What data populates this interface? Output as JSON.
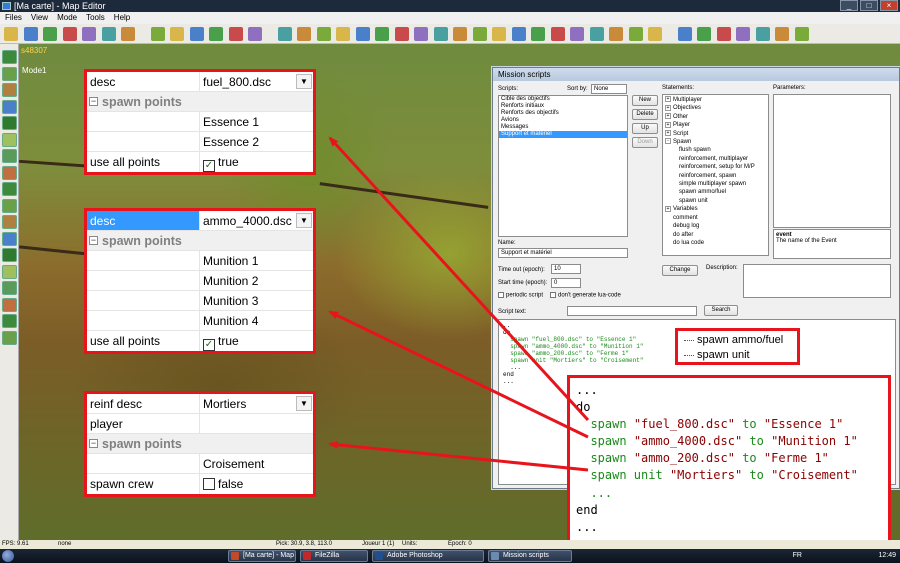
{
  "window": {
    "title": "[Ma carte] - Map Editor"
  },
  "menu": [
    "Files",
    "View",
    "Mode",
    "Tools",
    "Help"
  ],
  "viewport": {
    "coord_text": "s48307",
    "mode_text": "Mode1"
  },
  "mission_window": {
    "title": "Mission scripts",
    "scripts_label": "Scripts:",
    "sort_label": "Sort by:",
    "sort_value": "None",
    "scripts": [
      "Cible des objectifs",
      "Renforts initiaux",
      "Renforts des objectifs",
      "Avions",
      "Messages",
      "Support et matériel"
    ],
    "selected_script_index": 5,
    "buttons": {
      "new": "New",
      "delete": "Delete",
      "up": "Up",
      "down": "Down",
      "change": "Change",
      "search": "Search"
    },
    "statements_label": "Statements:",
    "parameters_label": "Parameters:",
    "statements": [
      {
        "label": "Multiplayer",
        "level": 0,
        "expander": "+"
      },
      {
        "label": "Objectives",
        "level": 0,
        "expander": "+"
      },
      {
        "label": "Other",
        "level": 0,
        "expander": "+"
      },
      {
        "label": "Player",
        "level": 0,
        "expander": "+"
      },
      {
        "label": "Script",
        "level": 0,
        "expander": "+"
      },
      {
        "label": "Spawn",
        "level": 0,
        "expander": "-"
      },
      {
        "label": "flush spawn",
        "level": 1,
        "expander": ""
      },
      {
        "label": "reinforcement, multiplayer",
        "level": 1,
        "expander": ""
      },
      {
        "label": "reinforcement, setup for M/P",
        "level": 1,
        "expander": ""
      },
      {
        "label": "reinforcement, spawn",
        "level": 1,
        "expander": ""
      },
      {
        "label": "simple multiplayer spawn",
        "level": 1,
        "expander": ""
      },
      {
        "label": "spawn ammo/fuel",
        "level": 1,
        "expander": ""
      },
      {
        "label": "spawn unit",
        "level": 1,
        "expander": ""
      },
      {
        "label": "Variables",
        "level": 0,
        "expander": "+"
      },
      {
        "label": "comment",
        "level": 0,
        "expander": ""
      },
      {
        "label": "debug log",
        "level": 0,
        "expander": ""
      },
      {
        "label": "do after",
        "level": 0,
        "expander": ""
      },
      {
        "label": "do lua code",
        "level": 0,
        "expander": ""
      }
    ],
    "event_help": {
      "title": "event",
      "text": "The name of the Event"
    },
    "name_label": "Name:",
    "name_value": "Support et matériel",
    "timeout_label": "Time out (epoch):",
    "timeout_value": "10",
    "starttime_label": "Start time (epoch):",
    "starttime_value": "0",
    "periodic_label": "periodic script",
    "nolua_label": "don't generate lua-code",
    "description_label": "Description:",
    "scripttext_label": "Script text:",
    "script_lines": [
      {
        "text": "..",
        "color": "black"
      },
      {
        "text": "do",
        "color": "black"
      },
      {
        "text": "  spawn \"fuel_800.dsc\" to \"Essence 1\"",
        "color": "green"
      },
      {
        "text": "  spawn \"ammo_4000.dsc\" to \"Munition 1\"",
        "color": "green"
      },
      {
        "text": "  spawn \"ammo_200.dsc\" to \"Ferme 1\"",
        "color": "green"
      },
      {
        "text": "  spawn unit \"Mortiers\" to \"Croisement\"",
        "color": "green"
      },
      {
        "text": "  ...",
        "color": "black"
      },
      {
        "text": "end",
        "color": "black"
      },
      {
        "text": "...",
        "color": "black"
      }
    ]
  },
  "panel_fuel": {
    "desc_key": "desc",
    "desc_value": "fuel_800.dsc",
    "section": "spawn points",
    "points": [
      "Essence 1",
      "Essence 2"
    ],
    "use_all_key": "use all points",
    "use_all_value": "true"
  },
  "panel_ammo": {
    "desc_key": "desc",
    "desc_value": "ammo_4000.dsc",
    "section": "spawn points",
    "points": [
      "Munition 1",
      "Munition 2",
      "Munition 3",
      "Munition 4"
    ],
    "use_all_key": "use all points",
    "use_all_value": "true"
  },
  "panel_unit": {
    "reinf_key": "reinf desc",
    "reinf_value": "Mortiers",
    "player_key": "player",
    "player_value": "",
    "section": "spawn points",
    "points": [
      "Croisement"
    ],
    "crew_key": "spawn crew",
    "crew_value": "false"
  },
  "tree_callout": [
    "spawn ammo/fuel",
    "spawn unit"
  ],
  "code_callout": [
    {
      "indent": "",
      "parts": [
        [
          "...",
          "black"
        ]
      ]
    },
    {
      "indent": "",
      "parts": [
        [
          "do",
          "black"
        ]
      ]
    },
    {
      "indent": "  ",
      "parts": [
        [
          "spawn ",
          "green"
        ],
        [
          "\"fuel_800.dsc\"",
          "maroon"
        ],
        [
          " to ",
          "green"
        ],
        [
          "\"Essence 1\"",
          "maroon"
        ]
      ]
    },
    {
      "indent": "  ",
      "parts": [
        [
          "spawn ",
          "green"
        ],
        [
          "\"ammo_4000.dsc\"",
          "maroon"
        ],
        [
          " to ",
          "green"
        ],
        [
          "\"Munition 1\"",
          "maroon"
        ]
      ]
    },
    {
      "indent": "  ",
      "parts": [
        [
          "spawn ",
          "green"
        ],
        [
          "\"ammo_200.dsc\"",
          "maroon"
        ],
        [
          " to ",
          "green"
        ],
        [
          "\"Ferme 1\"",
          "maroon"
        ]
      ]
    },
    {
      "indent": "  ",
      "parts": [
        [
          "spawn unit ",
          "green"
        ],
        [
          "\"Mortiers\"",
          "maroon"
        ],
        [
          " to ",
          "green"
        ],
        [
          "\"Croisement\"",
          "maroon"
        ]
      ]
    },
    {
      "indent": "  ",
      "parts": [
        [
          "...",
          "green"
        ]
      ]
    },
    {
      "indent": "",
      "parts": [
        [
          "end",
          "black"
        ]
      ]
    },
    {
      "indent": "",
      "parts": [
        [
          "...",
          "black"
        ]
      ]
    }
  ],
  "status": {
    "fps": "FPS: 9.61",
    "mode": "none",
    "pick": "Pick: 30.9, 3.8, 113.0",
    "player": "Joueur 1 (1)",
    "units": "Units:",
    "epoch": "Epoch: 0"
  },
  "taskbar": {
    "items": [
      {
        "label": "[Ma carte] - Map Ed...",
        "icon_color": "#c04a2a"
      },
      {
        "label": "FileZilla",
        "icon_color": "#c0282c"
      },
      {
        "label": "Adobe Photoshop",
        "icon_color": "#1f4f8f"
      },
      {
        "label": "Mission scripts",
        "icon_color": "#6a8ab0"
      }
    ],
    "lang": "FR",
    "clock": "12:49"
  },
  "colors": {
    "accent": "#e8141c",
    "selection": "#3399ff",
    "code_green": "#1a8a1a",
    "code_string": "#8b0000"
  }
}
